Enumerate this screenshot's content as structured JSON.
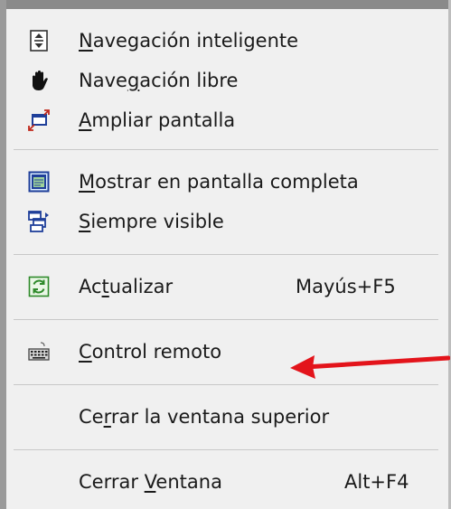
{
  "menu": {
    "items": [
      {
        "name": "navegacion-inteligente",
        "icon": "smart-navigation-icon",
        "before": "",
        "mnemonic": "N",
        "after": "avegación inteligente",
        "shortcut": ""
      },
      {
        "name": "navegacion-libre",
        "icon": "hand-icon",
        "before": "Nave",
        "mnemonic": "g",
        "after": "ación libre",
        "shortcut": ""
      },
      {
        "name": "ampliar-pantalla",
        "icon": "enlarge-screen-icon",
        "before": "",
        "mnemonic": "A",
        "after": "mpliar pantalla",
        "shortcut": ""
      },
      {
        "name": "mostrar-pantalla-completa",
        "icon": "fullscreen-icon",
        "before": "",
        "mnemonic": "M",
        "after": "ostrar en pantalla completa",
        "shortcut": ""
      },
      {
        "name": "siempre-visible",
        "icon": "always-on-top-icon",
        "before": "",
        "mnemonic": "S",
        "after": "iempre visible",
        "shortcut": ""
      },
      {
        "name": "actualizar",
        "icon": "refresh-icon",
        "before": "Ac",
        "mnemonic": "t",
        "after": "ualizar",
        "shortcut": "Mayús+F5"
      },
      {
        "name": "control-remoto",
        "icon": "keyboard-icon",
        "before": "",
        "mnemonic": "C",
        "after": "ontrol remoto",
        "shortcut": ""
      },
      {
        "name": "cerrar-ventana-superior",
        "icon": "",
        "before": "Ce",
        "mnemonic": "r",
        "after": "rar la ventana superior",
        "shortcut": ""
      },
      {
        "name": "cerrar-ventana",
        "icon": "",
        "before": "Cerrar ",
        "mnemonic": "V",
        "after": "entana",
        "shortcut": "Alt+F4"
      }
    ]
  },
  "annotation": {
    "icon": "red-arrow-icon",
    "color": "#e3141b"
  }
}
